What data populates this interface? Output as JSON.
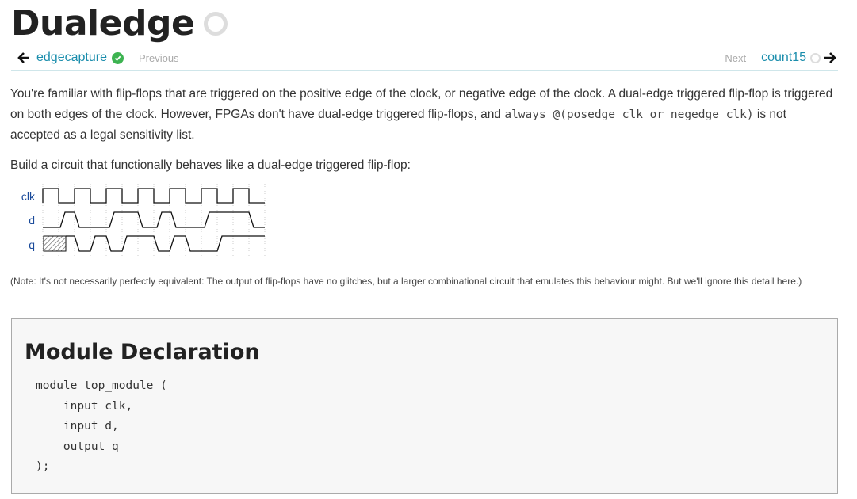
{
  "page": {
    "title": "Dualedge",
    "title_status_icon": "incomplete-circle"
  },
  "nav": {
    "prev_link": "edgecapture",
    "prev_label": "Previous",
    "prev_status_icon": "completed-check",
    "next_label": "Next",
    "next_link": "count15",
    "next_status_icon": "incomplete-circle"
  },
  "content": {
    "p1_a": "You're familiar with flip-flops that are triggered on the positive edge of the clock, or negative edge of the clock. A dual-edge triggered flip-flop is triggered on both edges of the clock. However, FPGAs don't have dual-edge triggered flip-flops, and ",
    "p1_code": "always @(posedge clk or negedge clk)",
    "p1_b": " is not accepted as a legal sensitivity list.",
    "p2": "Build a circuit that functionally behaves like a dual-edge triggered flip-flop:",
    "note": "(Note: It's not necessarily perfectly equivalent: The output of flip-flops have no glitches, but a larger combinational circuit that emulates this behaviour might. But we'll ignore this detail here.)"
  },
  "waveform": {
    "signals": [
      "clk",
      "d",
      "q"
    ]
  },
  "module": {
    "heading": "Module Declaration",
    "code": "module top_module (\n    input clk,\n    input d,\n    output q\n);"
  },
  "colors": {
    "link": "#1a8dac",
    "check": "#3db351",
    "signal_label": "#1a4a9a"
  }
}
